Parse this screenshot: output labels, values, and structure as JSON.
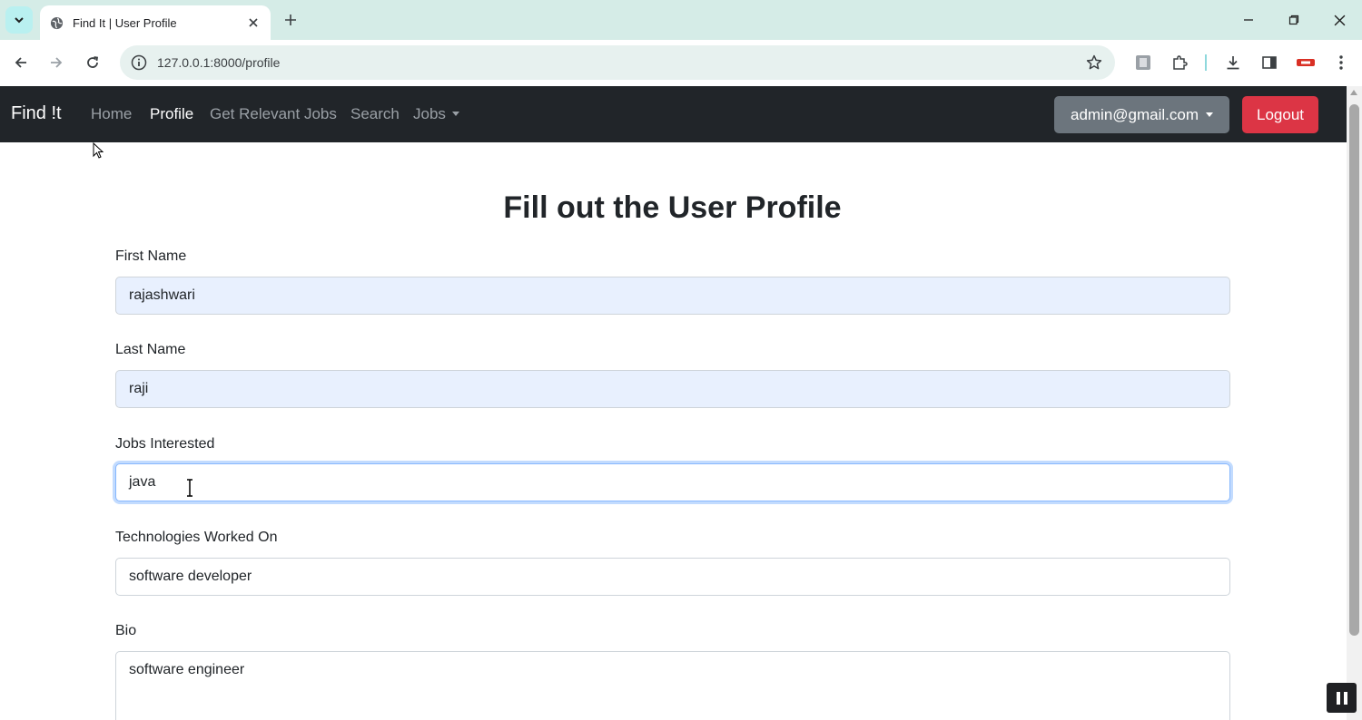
{
  "browser": {
    "tab_title": "Find It | User Profile",
    "url": "127.0.0.1:8000/profile"
  },
  "navbar": {
    "brand": "Find !t",
    "links": [
      "Home",
      "Profile",
      "Get Relevant Jobs",
      "Search",
      "Jobs"
    ],
    "active_link": "Profile",
    "user_email": "admin@gmail.com",
    "logout_label": "Logout"
  },
  "form": {
    "title": "Fill out the User Profile",
    "first_name": {
      "label": "First Name",
      "value": "rajashwari"
    },
    "last_name": {
      "label": "Last Name",
      "value": "raji"
    },
    "jobs_interested": {
      "label": "Jobs Interested",
      "value": "java"
    },
    "technologies": {
      "label": "Technologies Worked On",
      "value": "software developer"
    },
    "bio": {
      "label": "Bio",
      "value": "software engineer"
    }
  },
  "colors": {
    "navbar_bg": "#212529",
    "logout_bg": "#dc3545",
    "user_btn_bg": "#6c757d",
    "autofill_bg": "#e8f0fe",
    "focus_border": "#86b7fe",
    "tabbar_bg": "#d5ece7"
  }
}
